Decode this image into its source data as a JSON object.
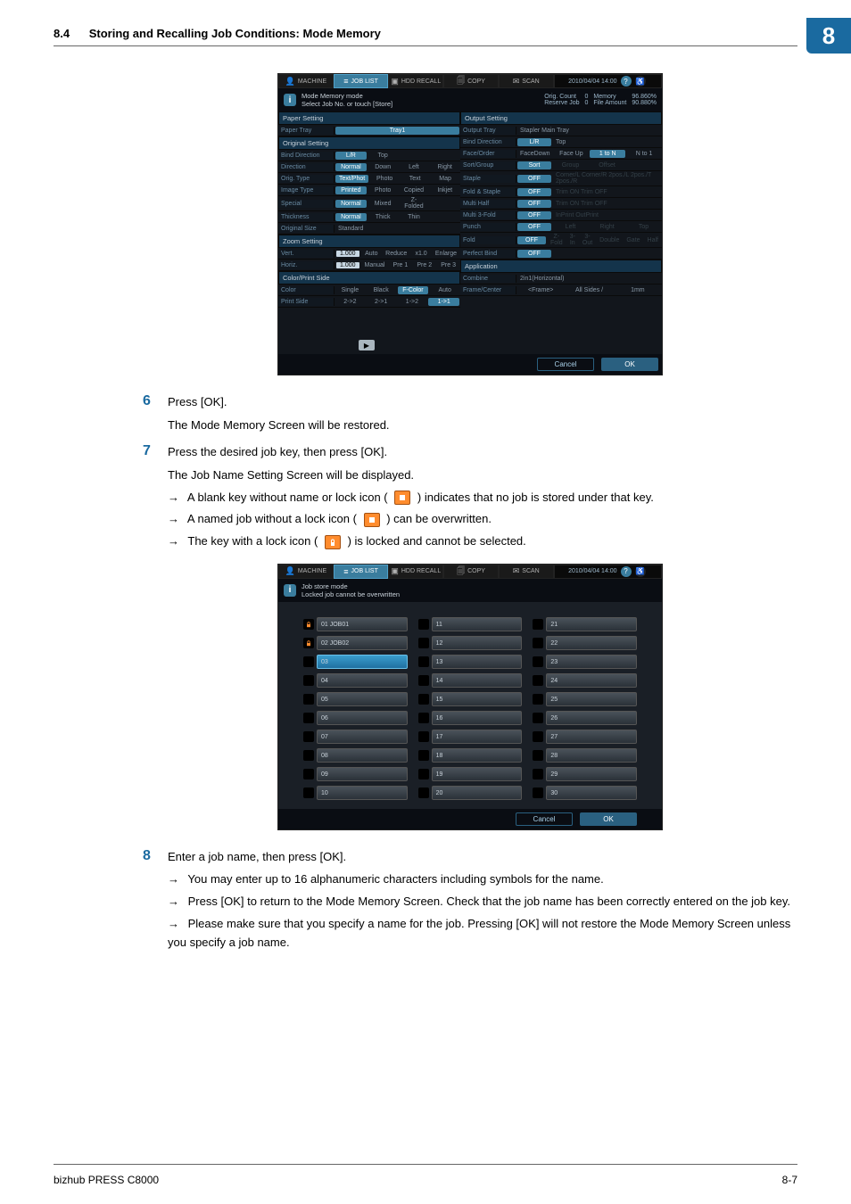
{
  "header": {
    "section_num": "8.4",
    "section_title": "Storing and Recalling Job Conditions: Mode Memory",
    "chapter_num": "8"
  },
  "steps": {
    "s6": {
      "num": "6",
      "text": "Press [OK].",
      "sub1": "The Mode Memory Screen will be restored."
    },
    "s7": {
      "num": "7",
      "text": "Press the desired job key, then press [OK].",
      "sub1": "The Job Name Setting Screen will be displayed.",
      "a1": "A blank key without name or lock icon (",
      "a1b": ") indicates that no job is stored under that key.",
      "a2": "A named job without a lock icon (",
      "a2b": ") can be overwritten.",
      "a3": "The key with a lock icon (",
      "a3b": ") is locked and cannot be selected."
    },
    "s8": {
      "num": "8",
      "text": "Enter a job name, then press [OK].",
      "a1": "You may enter up to 16 alphanumeric characters including symbols for the name.",
      "a2": "Press [OK] to return to the Mode Memory Screen. Check that the job name has been correctly entered on the job key.",
      "a3": "Please make sure that you specify a name for the job. Pressing [OK] will not restore the Mode Memory Screen unless you specify a job name."
    }
  },
  "screen1": {
    "tabs": {
      "t1": "MACHINE",
      "t2": "JOB LIST",
      "t3": "HDD RECALL",
      "t4": "COPY",
      "t5": "SCAN",
      "date": "2010/04/04 14:00"
    },
    "info": {
      "title": "Mode Memory mode",
      "sub": "Select Job No. or touch [Store]"
    },
    "status": {
      "k1": "Orig. Count",
      "v1": "0",
      "k2": "Memory",
      "v2": "96.860%",
      "k3": "Reserve Job",
      "v3": "0",
      "k4": "File Amount",
      "v4": "90.880%"
    },
    "paper": {
      "hdr": "Paper Setting",
      "rows": {
        "tray": {
          "lbl": "Paper Tray",
          "o1": "Tray1"
        }
      }
    },
    "original": {
      "hdr": "Original Setting",
      "rows": {
        "bind": {
          "lbl": "Bind Direction",
          "o1": "L/R",
          "o2": "Top"
        },
        "dir": {
          "lbl": "Direction",
          "o1": "Normal",
          "o2": "Down",
          "o3": "Left",
          "o4": "Right"
        },
        "type": {
          "lbl": "Orig. Type",
          "o1": "Text/Phot",
          "o2": "Photo",
          "o3": "Text",
          "o4": "Map"
        },
        "img": {
          "lbl": "Image Type",
          "o1": "Printed",
          "o2": "Photo",
          "o3": "Copied",
          "o4": "Inkjet"
        },
        "spec": {
          "lbl": "Special",
          "o1": "Normal",
          "o2": "Mixed",
          "o3": "Z-Folded"
        },
        "thk": {
          "lbl": "Thickness",
          "o1": "Normal",
          "o2": "Thick",
          "o3": "Thin"
        },
        "size": {
          "lbl": "Original Size",
          "o1": "Standard"
        }
      }
    },
    "zoom": {
      "hdr": "Zoom Setting",
      "rows": {
        "vert": {
          "lbl": "Vert.",
          "val": "1.000",
          "o1": "Auto",
          "o2": "Reduce",
          "o3": "x1.0",
          "o4": "Enlarge"
        },
        "horiz": {
          "lbl": "Horiz.",
          "val": "1.000",
          "o1": "Manual",
          "o2": "Pre 1",
          "o3": "Pre 2",
          "o4": "Pre 3"
        }
      }
    },
    "color": {
      "hdr": "Color/Print Side",
      "rows": {
        "col": {
          "lbl": "Color",
          "o1": "Single",
          "o2": "Black",
          "o3": "F-Color",
          "o4": "Auto"
        },
        "ps": {
          "lbl": "Print Side",
          "o1": "2->2",
          "o2": "2->1",
          "o3": "1->2",
          "o4": "1->1"
        }
      }
    },
    "output": {
      "hdr": "Output Setting",
      "rows": {
        "tray": {
          "lbl": "Output Tray",
          "o1": "Stapler Main Tray"
        },
        "bind": {
          "lbl": "Bind Direction",
          "o1": "L/R",
          "o2": "Top"
        },
        "face": {
          "lbl": "Face/Order",
          "o1": "FaceDown",
          "o2": "Face Up",
          "o3": "1 to N",
          "o4": "N to 1"
        },
        "sort": {
          "lbl": "Sort/Group",
          "o1": "Sort",
          "o2": "Group",
          "o3": "Offset"
        },
        "stap": {
          "lbl": "Staple",
          "o1": "OFF",
          "o2": "Corner/L Corner/R 2pos./L  2pos./T  2pos./R"
        },
        "fs": {
          "lbl": "Fold & Staple",
          "o1": "OFF",
          "o2": "Trim ON  Trim OFF"
        },
        "mh": {
          "lbl": "Multi Half",
          "o1": "OFF",
          "o2": "Trim ON  Trim OFF"
        },
        "m3": {
          "lbl": "Multi 3-Fold",
          "o1": "OFF",
          "o2": "InPrint  OutPrint"
        },
        "pun": {
          "lbl": "Punch",
          "o1": "OFF",
          "o2": "Left",
          "o3": "Right",
          "o4": "Top"
        },
        "fold": {
          "lbl": "Fold",
          "o1": "OFF",
          "o2": "Z-Fold",
          "o3": "3-In",
          "o4": "3-Out",
          "o5": "Double",
          "o6": "Gate",
          "o7": "Half"
        },
        "pb": {
          "lbl": "Perfect Bind",
          "o1": "OFF"
        }
      }
    },
    "app": {
      "hdr": "Application",
      "rows": {
        "comb": {
          "lbl": "Combine",
          "o1": "2in1(Horizontal)"
        },
        "fc": {
          "lbl": "Frame/Center",
          "o1": "<Frame>",
          "o2": "All Sides /",
          "o3": "1mm"
        }
      }
    },
    "play": "▶",
    "btns": {
      "cancel": "Cancel",
      "ok": "OK"
    }
  },
  "screen2": {
    "info": {
      "title": "Job store mode",
      "sub": "Locked job cannot be overwritten"
    },
    "slots": {
      "s01": "01  JOB01",
      "s02": "02  JOB02",
      "s03": "03",
      "s04": "04",
      "s05": "05",
      "s06": "06",
      "s07": "07",
      "s08": "08",
      "s09": "09",
      "s10": "10",
      "s11": "11",
      "s12": "12",
      "s13": "13",
      "s14": "14",
      "s15": "15",
      "s16": "16",
      "s17": "17",
      "s18": "18",
      "s19": "19",
      "s20": "20",
      "s21": "21",
      "s22": "22",
      "s23": "23",
      "s24": "24",
      "s25": "25",
      "s26": "26",
      "s27": "27",
      "s28": "28",
      "s29": "29",
      "s30": "30"
    },
    "btns": {
      "cancel": "Cancel",
      "ok": "OK"
    }
  },
  "footer": {
    "left": "bizhub PRESS C8000",
    "right": "8-7"
  }
}
